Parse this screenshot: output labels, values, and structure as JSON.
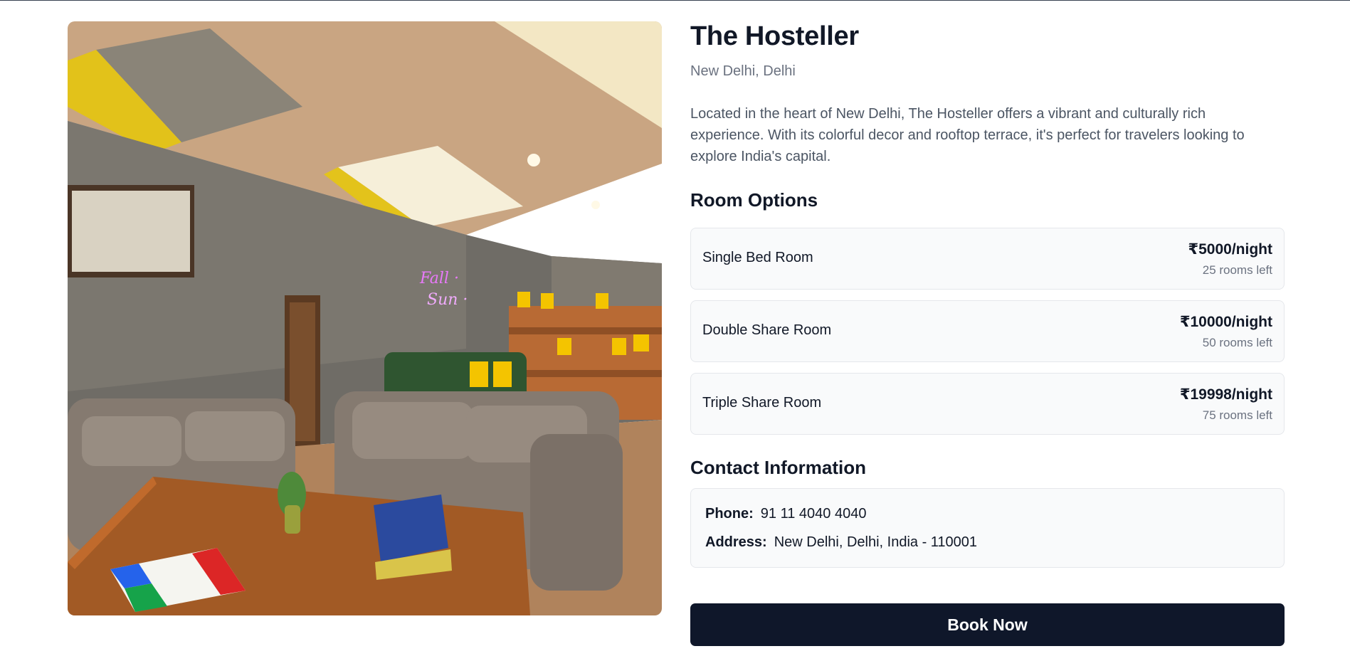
{
  "hostel": {
    "name": "The Hosteller",
    "location": "New Delhi, Delhi",
    "description": "Located in the heart of New Delhi, The Hosteller offers a vibrant and culturally rich experience. With its colorful decor and rooftop terrace, it's perfect for travelers looking to explore India's capital."
  },
  "rooms": {
    "heading": "Room Options",
    "items": [
      {
        "name": "Single Bed Room",
        "price": "₹5000/night",
        "availability": "25 rooms left"
      },
      {
        "name": "Double Share Room",
        "price": "₹10000/night",
        "availability": "50 rooms left"
      },
      {
        "name": "Triple Share Room",
        "price": "₹19998/night",
        "availability": "75 rooms left"
      }
    ]
  },
  "contact": {
    "heading": "Contact Information",
    "phone_label": "Phone:",
    "phone": "91 11 4040 4040",
    "address_label": "Address:",
    "address": "New Delhi, Delhi, India - 110001"
  },
  "actions": {
    "book_label": "Book Now"
  },
  "gallery": {
    "thumbnail_count": 3,
    "selected_thumbnail": 1
  },
  "colors": {
    "primary_button": "#0f172a",
    "heading_text": "#111827",
    "muted_text": "#6b7280",
    "card_background": "#f9fafb",
    "card_border": "#e5e7eb"
  }
}
